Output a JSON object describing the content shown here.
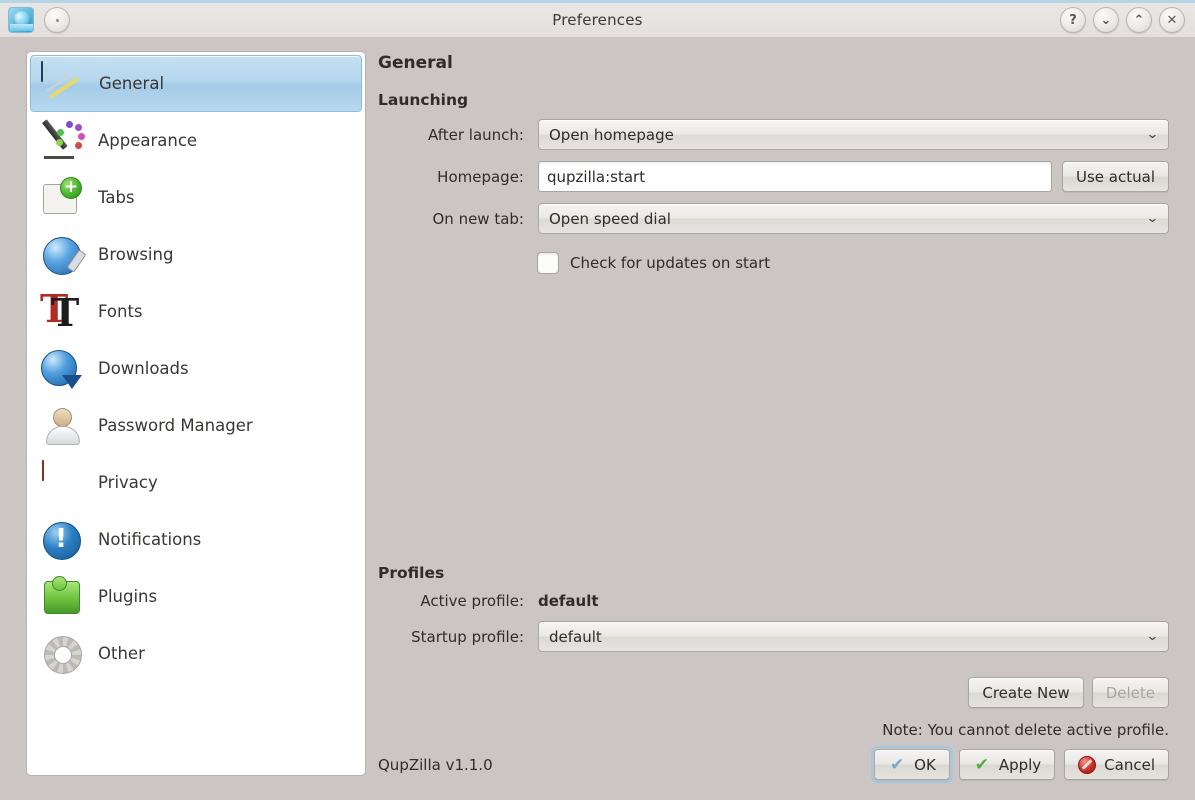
{
  "titlebar": {
    "title": "Preferences",
    "app_icon": "qupzilla-globe-icon",
    "menu_button": "window-menu-button",
    "help_label": "?",
    "minimize_label": "⌄",
    "maximize_label": "⌃",
    "close_label": "✕"
  },
  "sidebar": {
    "items": [
      {
        "label": "General",
        "icon": "general-icon",
        "selected": true
      },
      {
        "label": "Appearance",
        "icon": "appearance-icon",
        "selected": false
      },
      {
        "label": "Tabs",
        "icon": "tabs-icon",
        "selected": false
      },
      {
        "label": "Browsing",
        "icon": "browsing-icon",
        "selected": false
      },
      {
        "label": "Fonts",
        "icon": "fonts-icon",
        "selected": false
      },
      {
        "label": "Downloads",
        "icon": "downloads-icon",
        "selected": false
      },
      {
        "label": "Password Manager",
        "icon": "password-manager-icon",
        "selected": false
      },
      {
        "label": "Privacy",
        "icon": "privacy-icon",
        "selected": false
      },
      {
        "label": "Notifications",
        "icon": "notifications-icon",
        "selected": false
      },
      {
        "label": "Plugins",
        "icon": "plugins-icon",
        "selected": false
      },
      {
        "label": "Other",
        "icon": "other-icon",
        "selected": false
      }
    ]
  },
  "main": {
    "page_title": "General",
    "launching": {
      "group_title": "Launching",
      "after_launch_label": "After launch:",
      "after_launch_value": "Open homepage",
      "homepage_label": "Homepage:",
      "homepage_value": "qupzilla:start",
      "use_actual_label": "Use actual",
      "on_new_tab_label": "On new tab:",
      "on_new_tab_value": "Open speed dial",
      "check_updates_label": "Check for updates on start",
      "check_updates_checked": false
    },
    "profiles": {
      "group_title": "Profiles",
      "active_profile_label": "Active profile:",
      "active_profile_value": "default",
      "startup_profile_label": "Startup profile:",
      "startup_profile_value": "default",
      "create_new_label": "Create New",
      "delete_label": "Delete",
      "delete_disabled": true,
      "note": "Note: You cannot delete active profile."
    }
  },
  "footer": {
    "version": "QupZilla v1.1.0",
    "ok_label": "OK",
    "apply_label": "Apply",
    "cancel_label": "Cancel"
  },
  "colors": {
    "window_bg": "#cbc6c4",
    "titlebar_bg": "#e7e4e1",
    "titlebar_accent": "#b6d4e6",
    "sidebar_bg": "#ffffff",
    "selected_item": "#b4d6ed",
    "text": "#2f2c29",
    "focus_ring": "#9ec8e4"
  },
  "dot_colors": [
    "#7b4fd0",
    "#9a4fd0",
    "#d04fb8",
    "#55c04a",
    "#8ed44a",
    "#d04a4a",
    "#d0824a"
  ]
}
